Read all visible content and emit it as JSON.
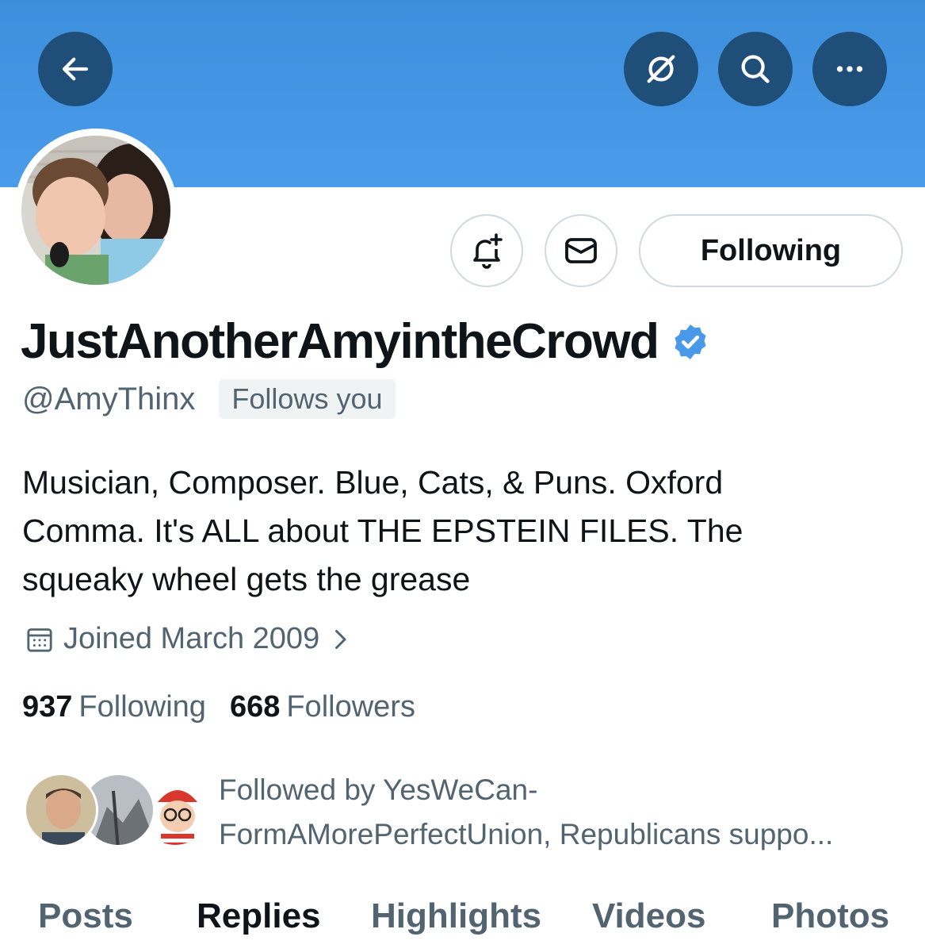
{
  "header": {
    "back_icon": "arrow-left-icon",
    "grok_icon": "slash-circle-icon",
    "search_icon": "search-icon",
    "more_icon": "more-horizontal-icon",
    "banner_color": "#4a9cea"
  },
  "profile": {
    "display_name": "JustAnotherAmyintheCrowd",
    "handle": "@AmyThinx",
    "follows_you": "Follows you",
    "verified_color": "#4a99e9",
    "bio": "Musician, Composer. Blue, Cats, & Puns. Oxford Comma. It's ALL about THE EPSTEIN FILES. The squeaky wheel gets the grease",
    "joined": "Joined March 2009",
    "following_count": "937",
    "following_label": "Following",
    "followers_count": "668",
    "followers_label": "Followers",
    "followed_by_line1": "Followed by YesWeCan-",
    "followed_by_line2": "FormAMorePerfectUnion, Republicans suppo..."
  },
  "actions": {
    "notify_icon": "bell-plus-icon",
    "message_icon": "envelope-icon",
    "following_button": "Following"
  },
  "tabs": [
    {
      "label": "Posts",
      "active": false
    },
    {
      "label": "Replies",
      "active": true
    },
    {
      "label": "Highlights",
      "active": false
    },
    {
      "label": "Videos",
      "active": false
    },
    {
      "label": "Photos",
      "active": false
    }
  ]
}
